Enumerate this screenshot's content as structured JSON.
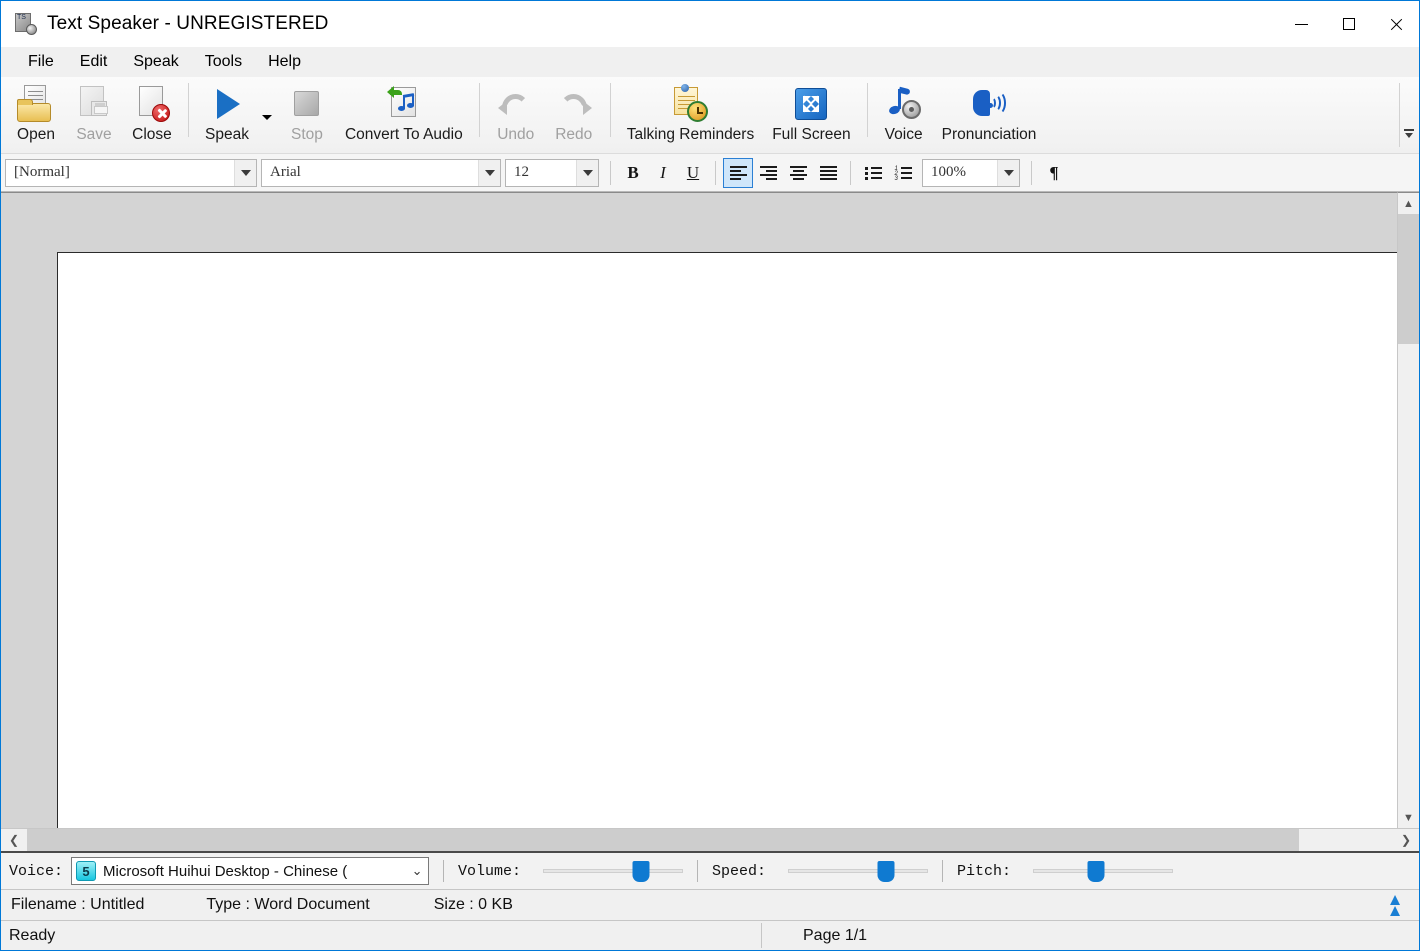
{
  "window": {
    "title": "Text Speaker - UNREGISTERED",
    "app_icon": "text-speaker-icon",
    "minimize": "minimize-icon",
    "maximize": "maximize-icon",
    "close": "close-icon"
  },
  "menubar": {
    "items": [
      {
        "label": "File"
      },
      {
        "label": "Edit"
      },
      {
        "label": "Speak"
      },
      {
        "label": "Tools"
      },
      {
        "label": "Help"
      }
    ]
  },
  "toolbar": {
    "buttons": [
      {
        "label": "Open",
        "icon": "open-folder-icon",
        "enabled": true
      },
      {
        "label": "Save",
        "icon": "save-disk-icon",
        "enabled": false
      },
      {
        "label": "Close",
        "icon": "close-document-icon",
        "enabled": true
      },
      {
        "label": "Speak",
        "icon": "play-triangle-icon",
        "enabled": true
      },
      {
        "label": "Stop",
        "icon": "stop-square-icon",
        "enabled": false
      },
      {
        "label": "Convert To Audio",
        "icon": "convert-audio-icon",
        "enabled": true
      },
      {
        "label": "Undo",
        "icon": "undo-arrow-icon",
        "enabled": false
      },
      {
        "label": "Redo",
        "icon": "redo-arrow-icon",
        "enabled": false
      },
      {
        "label": "Talking Reminders",
        "icon": "reminder-clock-icon",
        "enabled": true
      },
      {
        "label": "Full Screen",
        "icon": "fullscreen-icon",
        "enabled": true
      },
      {
        "label": "Voice",
        "icon": "voice-note-gear-icon",
        "enabled": true
      },
      {
        "label": "Pronunciation",
        "icon": "pronunciation-head-icon",
        "enabled": true
      }
    ],
    "overflow": "toolbar-overflow-icon"
  },
  "formatbar": {
    "style": {
      "value": "[Normal]"
    },
    "font": {
      "value": "Arial"
    },
    "size": {
      "value": "12"
    },
    "bold": "B",
    "italic": "I",
    "underline": "U",
    "align_left": "align-left-icon",
    "align_right": "align-right-icon",
    "align_center": "align-center-icon",
    "justify": "justify-icon",
    "bullet_list": "bullet-list-icon",
    "numbered_list": "numbered-list-icon",
    "zoom": {
      "value": "100%"
    },
    "pilcrow": "¶"
  },
  "editor": {
    "document_text": "",
    "vscroll": {
      "up": "▲",
      "down": "▼"
    },
    "hscroll": {
      "left": "❮",
      "right": "❯"
    }
  },
  "voicebar": {
    "voice_label": "Voice:",
    "voice_badge": "5",
    "voice_value": "Microsoft Huihui Desktop - Chinese (",
    "volume_label": "Volume:",
    "volume_percent": 70,
    "speed_label": "Speed:",
    "speed_percent": 70,
    "pitch_label": "Pitch:",
    "pitch_percent": 45
  },
  "infobar": {
    "filename": "Filename : Untitled",
    "type": "Type : Word Document",
    "size": "Size : 0 KB",
    "expand": "expand-up-icon"
  },
  "statusbar": {
    "status": "Ready",
    "page": "Page 1/1"
  },
  "colors": {
    "accent": "#0078d7",
    "slider": "#0f7ad1",
    "window_bg": "#f0f0f0",
    "page_bg": "#ffffff",
    "doc_area_bg": "#d4d4d4"
  }
}
